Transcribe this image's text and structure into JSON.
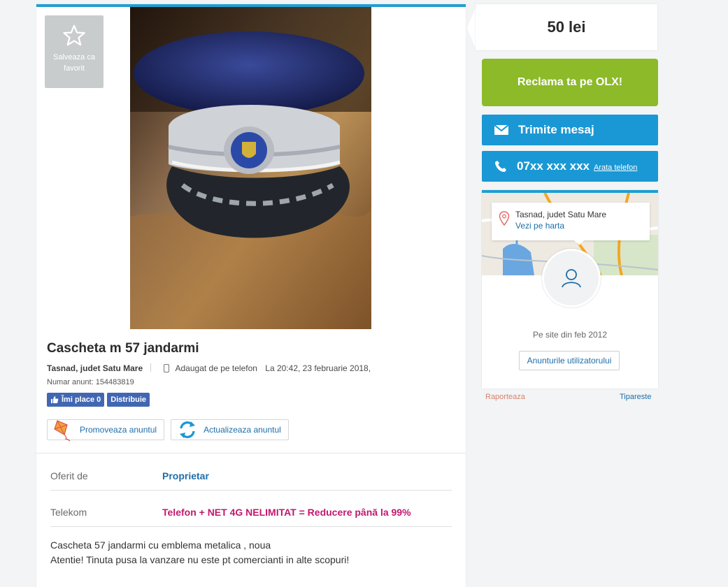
{
  "favorite": {
    "label": "Salveaza ca favorit"
  },
  "ad": {
    "title": "Cascheta m 57 jandarmi",
    "location": "Tasnad, judet Satu Mare",
    "added_via": "Adaugat de pe telefon",
    "added_at": "La 20:42, 23 februarie 2018,",
    "ad_number": "Numar anunt: 154483819"
  },
  "social": {
    "like_label": "Îmi place 0",
    "share_label": "Distribuie"
  },
  "actions": {
    "promote_label": "Promoveaza anuntul",
    "refresh_label": "Actualizeaza anuntul"
  },
  "properties": [
    {
      "key": "Oferit de",
      "value": "Proprietar"
    },
    {
      "key": "Telekom",
      "value": "Telefon + NET 4G NELIMITAT = Reducere până la 99%"
    }
  ],
  "description": [
    "Cascheta 57 jandarmi cu emblema metalica , noua",
    "Atentie! Tinuta pusa la vanzare nu este pt comercianti in alte scopuri!"
  ],
  "sidebar": {
    "price": "50 lei",
    "olx_button": "Reclama ta pe OLX!",
    "message_button": "Trimite mesaj",
    "phone_number": "07xx xxx xxx",
    "phone_reveal": "Arata telefon",
    "map_location": "Tasnad, judet Satu Mare",
    "map_link": "Vezi pe harta",
    "member_since": "Pe site din feb 2012",
    "user_ads_button": "Anunturile utilizatorului",
    "report_link": "Raporteaza",
    "print_link": "Tipareste"
  },
  "colors": {
    "accent_blue": "#1a98d5",
    "olx_green": "#8dba29",
    "facebook_blue": "#4267b2",
    "promo_pink": "#c2186f"
  },
  "icons": [
    "star-icon",
    "phone-device-icon",
    "thumbs-up-icon",
    "kite-icon",
    "refresh-icon",
    "envelope-icon",
    "phone-icon",
    "map-pin-icon",
    "user-icon"
  ]
}
